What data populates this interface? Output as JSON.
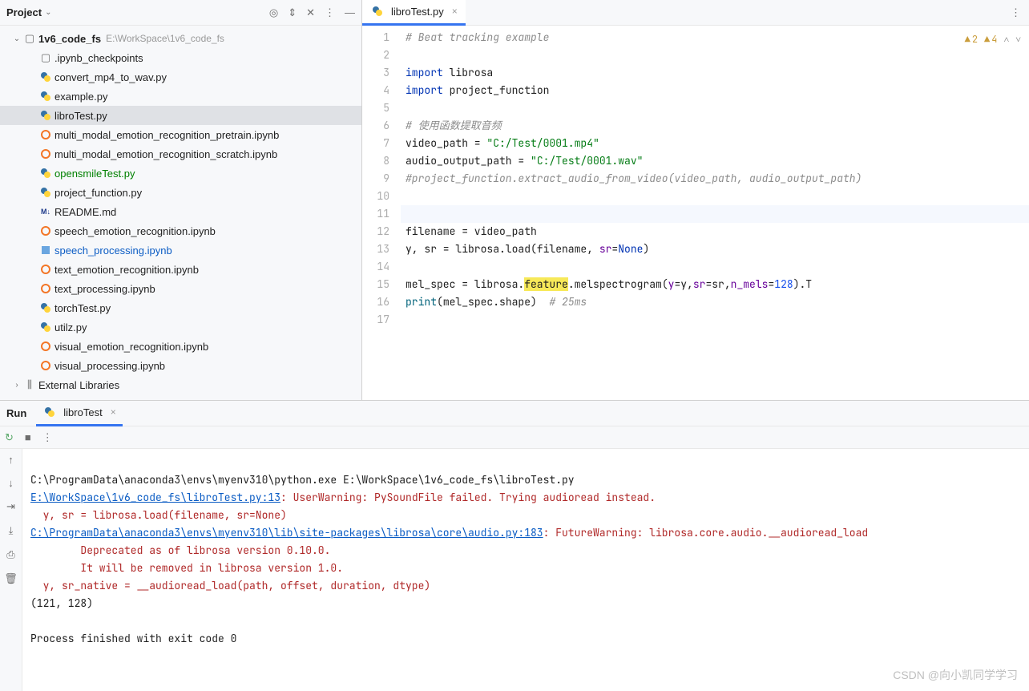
{
  "project": {
    "panel_title": "Project",
    "root_name": "1v6_code_fs",
    "root_path": "E:\\WorkSpace\\1v6_code_fs",
    "external_libs": "External Libraries",
    "files": [
      {
        "name": ".ipynb_checkpoints",
        "type": "folder"
      },
      {
        "name": "convert_mp4_to_wav.py",
        "type": "py"
      },
      {
        "name": "example.py",
        "type": "py"
      },
      {
        "name": "libroTest.py",
        "type": "py",
        "selected": true
      },
      {
        "name": "multi_modal_emotion_recognition_pretrain.ipynb",
        "type": "jup"
      },
      {
        "name": "multi_modal_emotion_recognition_scratch.ipynb",
        "type": "jup"
      },
      {
        "name": "opensmileTest.py",
        "type": "py",
        "style": "green"
      },
      {
        "name": "project_function.py",
        "type": "py"
      },
      {
        "name": "README.md",
        "type": "md"
      },
      {
        "name": "speech_emotion_recognition.ipynb",
        "type": "jup"
      },
      {
        "name": "speech_processing.ipynb",
        "type": "jupblue",
        "style": "blue"
      },
      {
        "name": "text_emotion_recognition.ipynb",
        "type": "jup"
      },
      {
        "name": "text_processing.ipynb",
        "type": "jup"
      },
      {
        "name": "torchTest.py",
        "type": "py"
      },
      {
        "name": "utilz.py",
        "type": "py"
      },
      {
        "name": "visual_emotion_recognition.ipynb",
        "type": "jup"
      },
      {
        "name": "visual_processing.ipynb",
        "type": "jup"
      }
    ]
  },
  "editor": {
    "tab_name": "libroTest.py",
    "warnings": {
      "a": "2",
      "b": "4"
    },
    "code": {
      "l1": "# Beat tracking example",
      "l3_kw": "import",
      "l3_rest": " librosa",
      "l4_kw": "import",
      "l4_rest": " project_function",
      "l6": "# 使用函数提取音频",
      "l7_a": "video_path = ",
      "l7_s": "\"C:/Test/0001.mp4\"",
      "l8_a": "audio_output_path = ",
      "l8_s": "\"C:/Test/0001.wav\"",
      "l9": "#project_function.extract_audio_from_video(video_path, audio_output_path)",
      "l12": "filename = video_path",
      "l13_a": "y, sr = librosa.load(filename, ",
      "l13_p": "sr",
      "l13_b": "=",
      "l13_kw": "None",
      "l13_c": ")",
      "l15_a": "mel_spec = librosa.",
      "l15_hl": "feature",
      "l15_b": ".melspectrogram(",
      "l15_p1": "y",
      "l15_e1": "=y,",
      "l15_p2": "sr",
      "l15_e2": "=sr,",
      "l15_p3": "n_mels",
      "l15_e3": "=",
      "l15_n": "128",
      "l15_c": ").T",
      "l16_fn": "print",
      "l16_a": "(mel_spec.shape)  ",
      "l16_c": "# 25ms"
    },
    "line_count": 17
  },
  "run": {
    "panel_label": "Run",
    "tab_name": "libroTest",
    "console": {
      "l1": "C:\\ProgramData\\anaconda3\\envs\\myenv310\\python.exe E:\\WorkSpace\\1v6_code_fs\\libroTest.py",
      "l2_link": "E:\\WorkSpace\\1v6_code_fs\\libroTest.py:13",
      "l2_rest": ": UserWarning: PySoundFile failed. Trying audioread instead.",
      "l3": "  y, sr = librosa.load(filename, sr=None)",
      "l4_link": "C:\\ProgramData\\anaconda3\\envs\\myenv310\\lib\\site-packages\\librosa\\core\\audio.py:183",
      "l4_rest": ": FutureWarning: librosa.core.audio.__audioread_load",
      "l5": "\tDeprecated as of librosa version 0.10.0.",
      "l6": "\tIt will be removed in librosa version 1.0.",
      "l7": "  y, sr_native = __audioread_load(path, offset, duration, dtype)",
      "l8": "(121, 128)",
      "l9": "",
      "l10": "Process finished with exit code 0"
    }
  },
  "watermark": "CSDN @向小凯同学学习"
}
